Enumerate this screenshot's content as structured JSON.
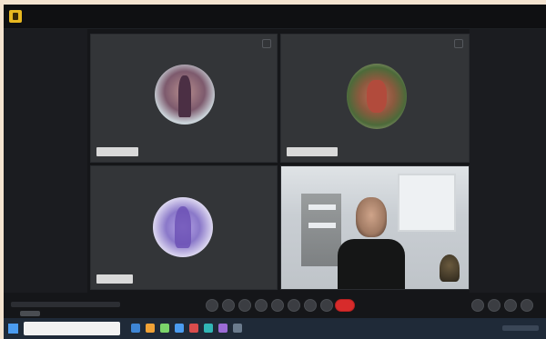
{
  "app": {
    "title": ""
  },
  "tiles": [
    {
      "id": "p1",
      "name": "",
      "type": "avatar"
    },
    {
      "id": "p2",
      "name": "",
      "type": "avatar"
    },
    {
      "id": "p3",
      "name": "",
      "type": "avatar"
    },
    {
      "id": "p4",
      "name": "",
      "type": "video"
    }
  ],
  "controls": {
    "items": [
      "mic",
      "camera",
      "share",
      "reactions",
      "participants",
      "chat",
      "more",
      "end-call"
    ]
  },
  "colors": {
    "end_call": "#d72b2b",
    "background": "#151619",
    "tile": "#333538"
  }
}
